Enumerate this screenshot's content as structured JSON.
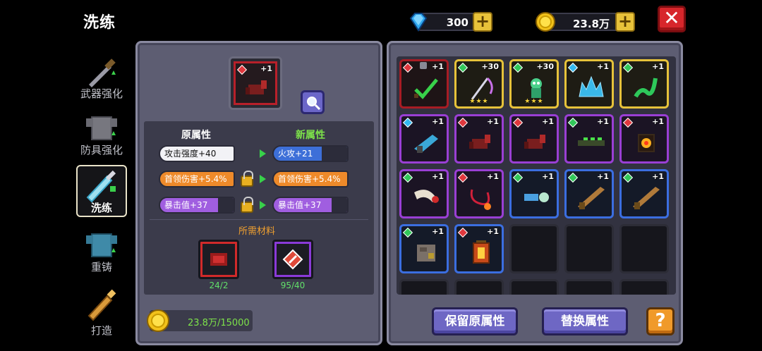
{
  "header": {
    "title": "洗练",
    "gems": "300",
    "gold": "23.8万",
    "plus_label": "+",
    "close_label": "✕"
  },
  "nav": [
    {
      "label": "武器强化",
      "icon": "sword-upgrade-icon"
    },
    {
      "label": "防具强化",
      "icon": "armor-upgrade-icon"
    },
    {
      "label": "洗练",
      "icon": "refine-sword-icon",
      "active": true
    },
    {
      "label": "重铸",
      "icon": "reforge-armor-icon"
    },
    {
      "label": "打造",
      "icon": "forge-weapon-icon"
    }
  ],
  "refine": {
    "item_level": "+1",
    "original_header": "原属性",
    "new_header": "新属性",
    "original": [
      "攻击强度+40",
      "首领伤害+5.4%",
      "暴击值+37"
    ],
    "new": [
      "火攻+21",
      "首领伤害+5.4%",
      "暴击值+37"
    ],
    "materials_label": "所需材料",
    "materials": [
      {
        "count": "24/2"
      },
      {
        "count": "95/40"
      }
    ],
    "gold_cost": "23.8万/15000"
  },
  "inventory": [
    {
      "rarity": "red",
      "gem": "red",
      "level": "+1",
      "stars": "",
      "icon": "green-check-sword-icon"
    },
    {
      "rarity": "gold",
      "gem": "green",
      "level": "+30",
      "stars": "★★★",
      "icon": "scythe-icon"
    },
    {
      "rarity": "gold",
      "gem": "green",
      "level": "+30",
      "stars": "★★★",
      "icon": "spirit-pet-icon"
    },
    {
      "rarity": "gold",
      "gem": "blue",
      "level": "+1",
      "stars": "",
      "icon": "crystal-crown-icon"
    },
    {
      "rarity": "gold",
      "gem": "green",
      "level": "+1",
      "stars": "",
      "icon": "green-serpent-icon"
    },
    {
      "rarity": "purple",
      "gem": "blue",
      "level": "+1",
      "stars": "",
      "icon": "crystal-gun-icon"
    },
    {
      "rarity": "purple",
      "gem": "red",
      "level": "+1",
      "stars": "",
      "icon": "red-gauntlet-icon"
    },
    {
      "rarity": "purple",
      "gem": "red",
      "level": "+1",
      "stars": "",
      "icon": "red-gauntlet-icon"
    },
    {
      "rarity": "purple",
      "gem": "green",
      "level": "+1",
      "stars": "",
      "icon": "green-rifle-icon"
    },
    {
      "rarity": "purple",
      "gem": "red",
      "level": "+1",
      "stars": "",
      "icon": "fire-orb-icon"
    },
    {
      "rarity": "purple",
      "gem": "green",
      "level": "+1",
      "stars": "",
      "icon": "horn-icon"
    },
    {
      "rarity": "purple",
      "gem": "red",
      "level": "+1",
      "stars": "",
      "icon": "fire-whip-icon"
    },
    {
      "rarity": "blue",
      "gem": "green",
      "level": "+1",
      "stars": "",
      "icon": "orb-gun-icon"
    },
    {
      "rarity": "blue",
      "gem": "green",
      "level": "+1",
      "stars": "",
      "icon": "wooden-rifle-icon"
    },
    {
      "rarity": "blue",
      "gem": "green",
      "level": "+1",
      "stars": "",
      "icon": "wooden-rifle-icon"
    },
    {
      "rarity": "blue",
      "gem": "green",
      "level": "+1",
      "stars": "",
      "icon": "stone-block-icon"
    },
    {
      "rarity": "blue",
      "gem": "red",
      "level": "+1",
      "stars": "",
      "icon": "lantern-icon"
    }
  ],
  "actions": {
    "keep_label": "保留原属性",
    "replace_label": "替换属性",
    "help_label": "?"
  },
  "colors": {
    "panel": "#5d5d72",
    "accent_green": "#38d14a",
    "close_red": "#d7262b"
  }
}
